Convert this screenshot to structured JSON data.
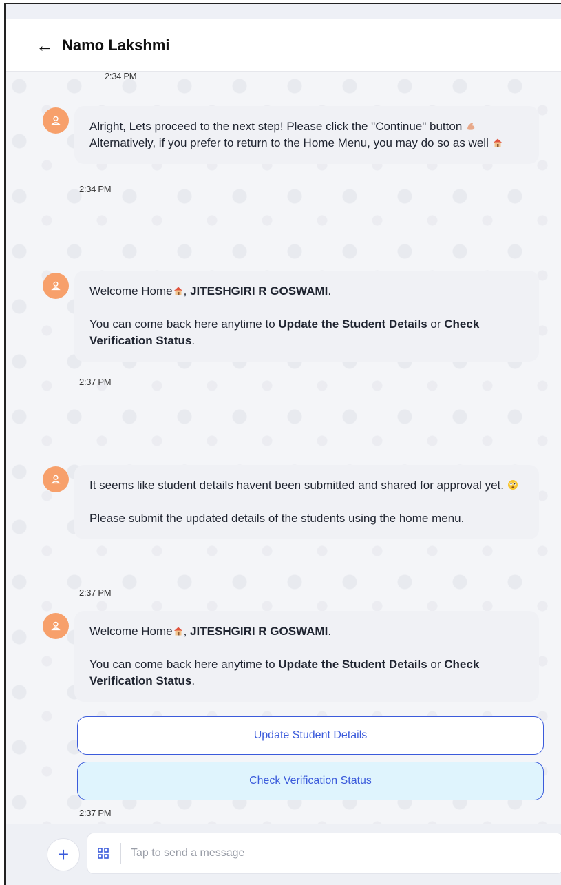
{
  "header": {
    "back_icon": "arrow-left-icon",
    "title": "Namo Lakshmi"
  },
  "top_timestamp": "2:34 PM",
  "messages": [
    {
      "avatar_icon": "user-icon",
      "paragraphs": [
        {
          "parts": [
            {
              "text": "Alright, Lets proceed to the next step! Please click the \"Continue\" button "
            },
            {
              "emoji": "flexed-biceps-emoji"
            },
            {
              "text": " Alternatively, if you prefer to return to the Home Menu, you may do so as well "
            },
            {
              "emoji": "house-emoji"
            }
          ]
        }
      ],
      "time": "2:34 PM"
    },
    {
      "avatar_icon": "user-icon",
      "paragraphs": [
        {
          "parts": [
            {
              "text": "Welcome Home"
            },
            {
              "emoji": "house-emoji"
            },
            {
              "text": ", "
            },
            {
              "text": "JITESHGIRI R GOSWAMI",
              "bold": true
            },
            {
              "text": "."
            }
          ]
        },
        {
          "parts": [
            {
              "text": "You can come back here anytime to "
            },
            {
              "text": "Update the Student Details",
              "bold": true
            },
            {
              "text": " or "
            },
            {
              "text": "Check Verification Status",
              "bold": true
            },
            {
              "text": "."
            }
          ]
        }
      ],
      "time": "2:37 PM"
    },
    {
      "avatar_icon": "user-icon",
      "paragraphs": [
        {
          "parts": [
            {
              "text": "It seems like student details havent been submitted and shared for approval yet. "
            },
            {
              "emoji": "flushed-face-emoji"
            }
          ]
        },
        {
          "parts": [
            {
              "text": "Please submit the updated details of the students using the home menu."
            }
          ]
        }
      ],
      "time": "2:37 PM"
    },
    {
      "avatar_icon": "user-icon",
      "paragraphs": [
        {
          "parts": [
            {
              "text": "Welcome Home"
            },
            {
              "emoji": "house-emoji"
            },
            {
              "text": ", "
            },
            {
              "text": "JITESHGIRI R GOSWAMI",
              "bold": true
            },
            {
              "text": "."
            }
          ]
        },
        {
          "parts": [
            {
              "text": "You can come back here anytime to "
            },
            {
              "text": "Update the Student Details",
              "bold": true
            },
            {
              "text": " or "
            },
            {
              "text": "Check Verification Status",
              "bold": true
            },
            {
              "text": "."
            }
          ]
        }
      ],
      "quick_replies": [
        {
          "label": "Update Student Details",
          "selected": false
        },
        {
          "label": "Check Verification Status",
          "selected": true
        }
      ],
      "time": "2:37 PM"
    }
  ],
  "composer": {
    "add_icon": "plus-icon",
    "menu_icon": "grid-icon",
    "placeholder": "Tap to send a message"
  },
  "colors": {
    "accent": "#3b5bdb",
    "avatar": "#f7a06b",
    "selected_reply": "#dff4fd"
  }
}
